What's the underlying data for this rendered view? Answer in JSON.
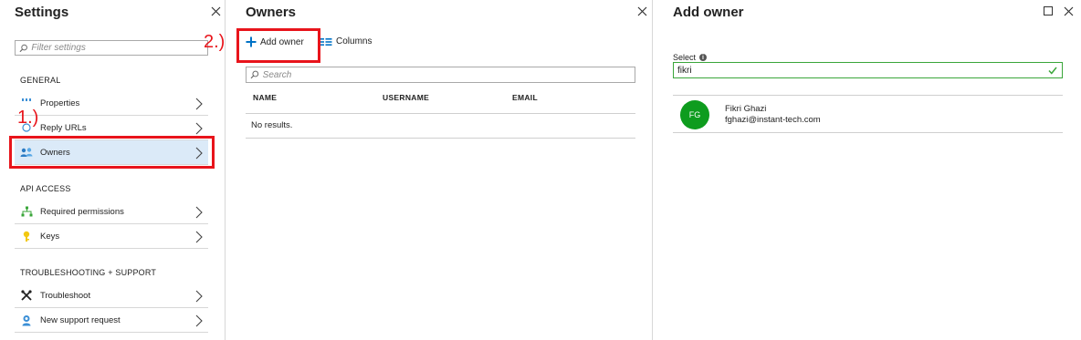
{
  "settings": {
    "title": "Settings",
    "filter_placeholder": "Filter settings",
    "sections": {
      "general": "GENERAL",
      "api_access": "API ACCESS",
      "troubleshooting": "TROUBLESHOOTING + SUPPORT"
    },
    "items": {
      "properties": "Properties",
      "reply_urls": "Reply URLs",
      "owners": "Owners",
      "required_permissions": "Required permissions",
      "keys": "Keys",
      "troubleshoot": "Troubleshoot",
      "new_support_request": "New support request"
    },
    "selected_item": "owners"
  },
  "owners": {
    "title": "Owners",
    "add_owner_label": "Add owner",
    "columns_label": "Columns",
    "search_placeholder": "Search",
    "columns": [
      "NAME",
      "USERNAME",
      "EMAIL"
    ],
    "empty_text": "No results."
  },
  "add_owner": {
    "title": "Add owner",
    "select_label": "Select",
    "select_value": "fikri",
    "result": {
      "initials": "FG",
      "name": "Fikri Ghazi",
      "email": "fghazi@instant-tech.com"
    }
  },
  "annotations": {
    "step1": "1.)",
    "step2": "2.)"
  },
  "colors": {
    "accent_blue": "#0072c6",
    "selected_bg": "#dbeaf8",
    "annotation_red": "#e8141b",
    "avatar_green": "#0e9c1e",
    "valid_green": "#3aa63a"
  }
}
